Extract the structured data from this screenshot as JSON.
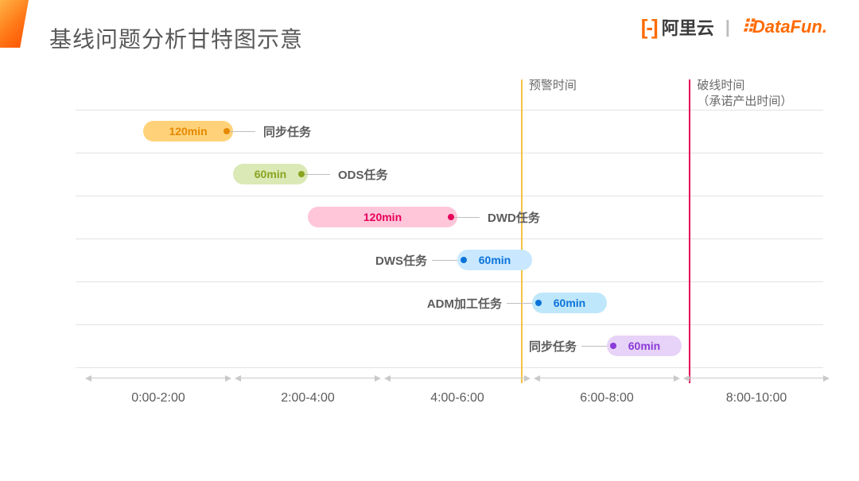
{
  "title": "基线问题分析甘特图示意",
  "brand": {
    "aliyun_bracket": "[-]",
    "aliyun_text": "阿里云",
    "divider": "|",
    "datafun_dots": "⠿",
    "datafun_text": "DataFun."
  },
  "markers": {
    "warn": {
      "label": "预警时间",
      "hour": 5.85
    },
    "break": {
      "label": "破线时间\n（承诺产出时间）",
      "hour": 8.1
    }
  },
  "chart_data": {
    "type": "gantt",
    "title": "基线问题分析甘特图示意",
    "xaxis": {
      "unit": "hours",
      "range": [
        0,
        10
      ],
      "ticks": [
        {
          "center": 1,
          "label": "0:00-2:00"
        },
        {
          "center": 3,
          "label": "2:00-4:00"
        },
        {
          "center": 5,
          "label": "4:00-6:00"
        },
        {
          "center": 7,
          "label": "6:00-8:00"
        },
        {
          "center": 9,
          "label": "8:00-10:00"
        }
      ]
    },
    "markers": [
      {
        "name": "预警时间",
        "hour": 5.85
      },
      {
        "name": "破线时间（承诺产出时间）",
        "hour": 8.1
      }
    ],
    "tasks": [
      {
        "row": 0,
        "name": "同步任务",
        "start": 0.8,
        "end": 2.0,
        "duration_min": 120,
        "label_side": "right",
        "color": "orange"
      },
      {
        "row": 1,
        "name": "ODS任务",
        "start": 2.0,
        "end": 3.0,
        "duration_min": 60,
        "label_side": "right",
        "color": "olive"
      },
      {
        "row": 2,
        "name": "DWD任务",
        "start": 3.0,
        "end": 5.0,
        "duration_min": 120,
        "label_side": "right",
        "color": "pink"
      },
      {
        "row": 3,
        "name": "DWS任务",
        "start": 5.0,
        "end": 6.0,
        "duration_min": 60,
        "label_side": "left",
        "color": "blue"
      },
      {
        "row": 4,
        "name": "ADM加工任务",
        "start": 6.0,
        "end": 7.0,
        "duration_min": 60,
        "label_side": "left",
        "color": "sky"
      },
      {
        "row": 5,
        "name": "同步任务",
        "start": 7.0,
        "end": 8.0,
        "duration_min": 60,
        "label_side": "left",
        "color": "purple"
      }
    ]
  }
}
